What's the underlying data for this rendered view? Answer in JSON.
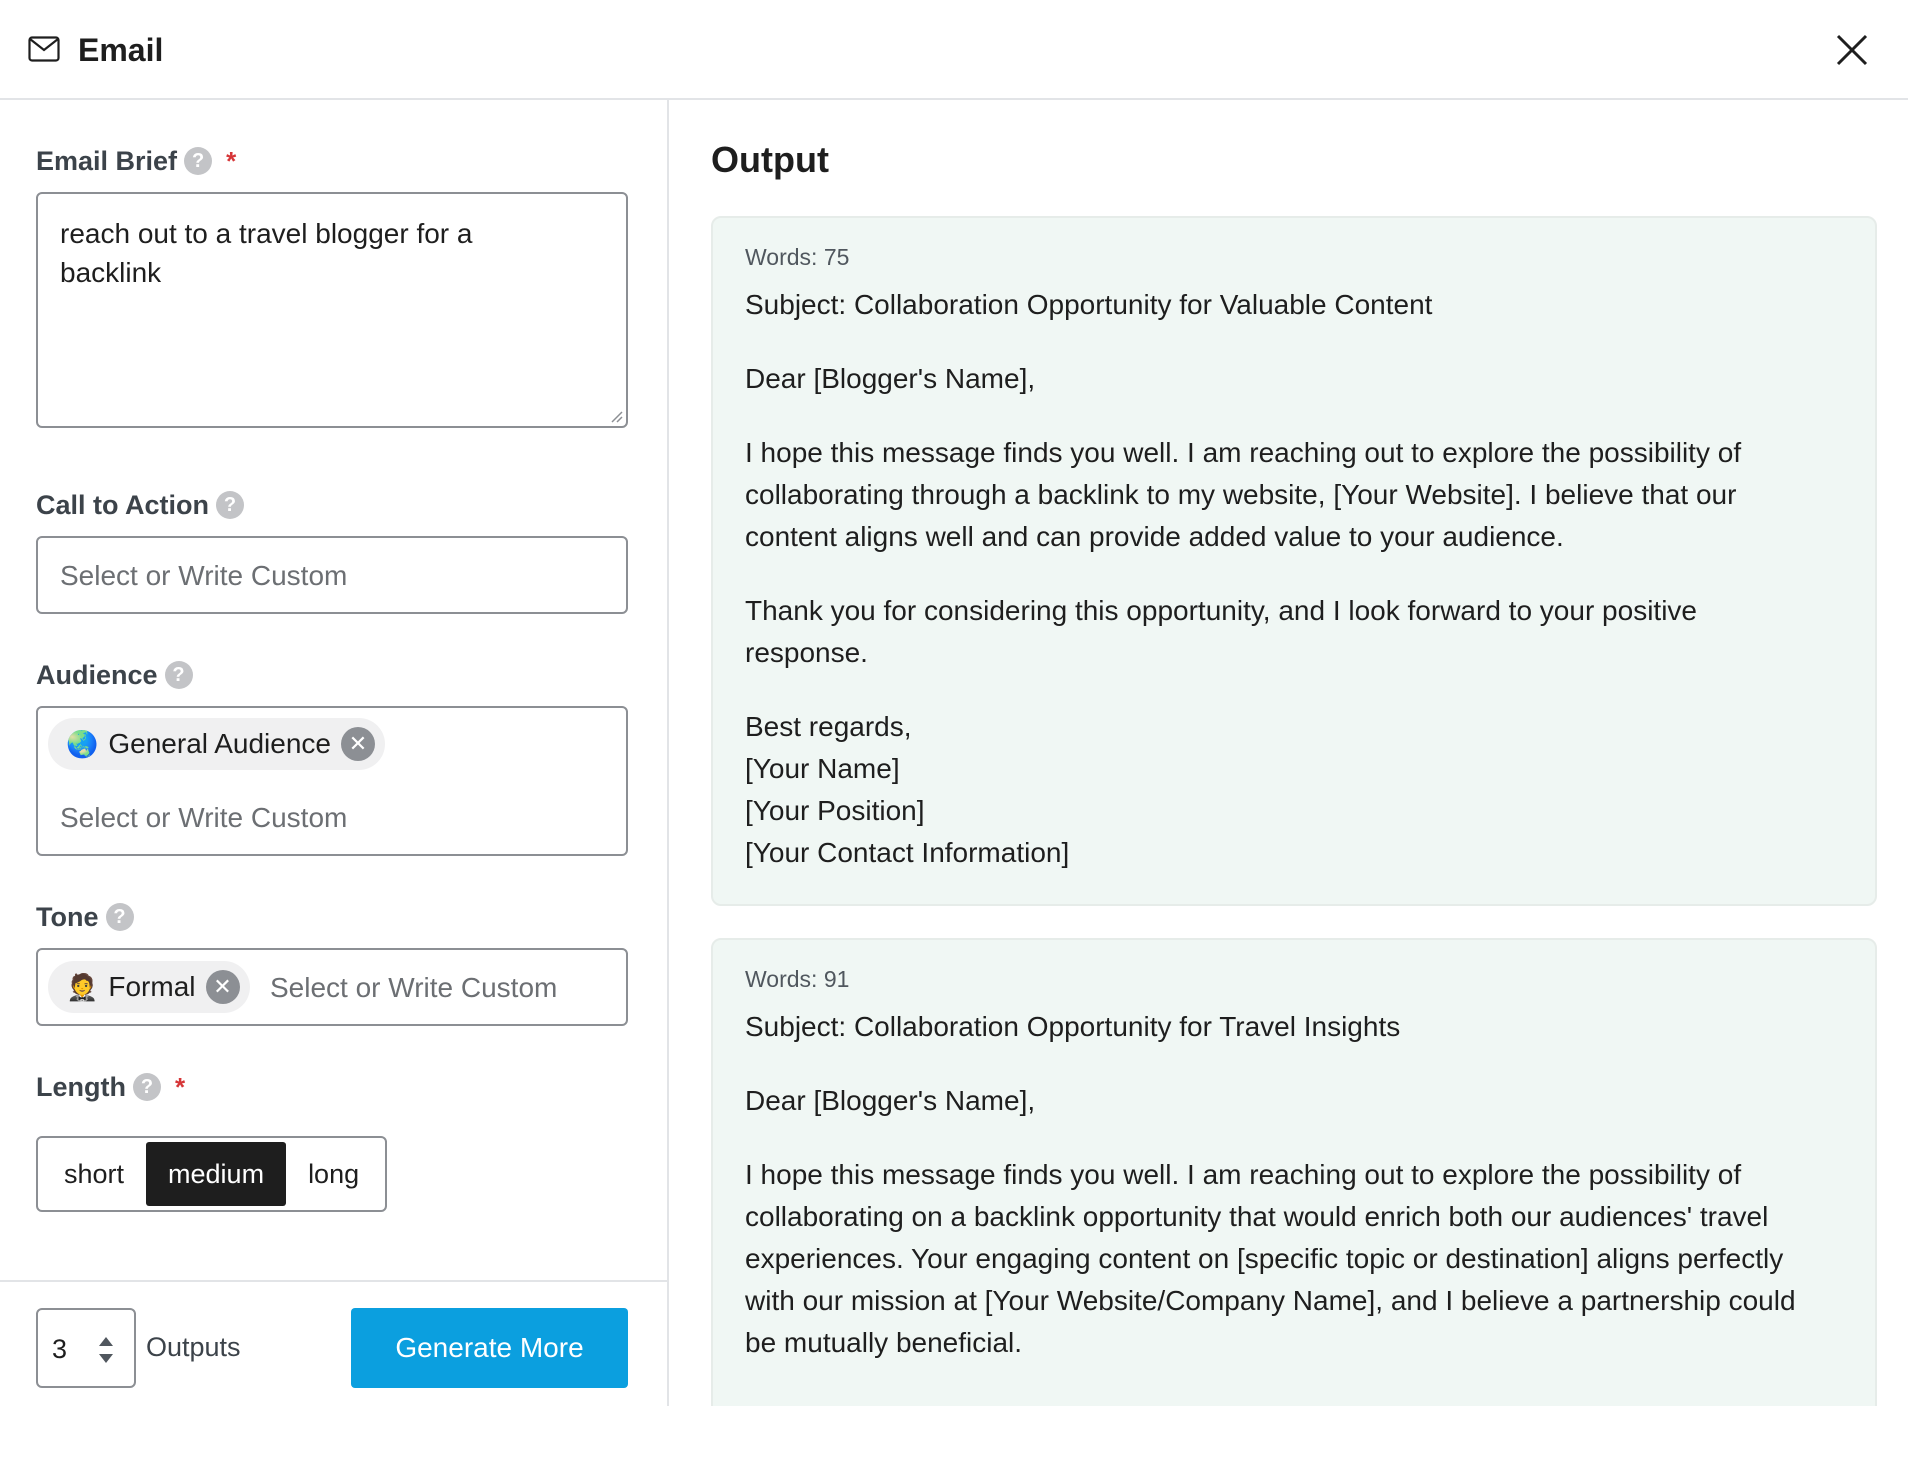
{
  "header": {
    "title": "Email"
  },
  "form": {
    "email_brief": {
      "label": "Email Brief",
      "help": "?",
      "required_mark": "*",
      "value_line1": "reach out to a travel blogger for a",
      "value_line2": "backlink"
    },
    "call_to_action": {
      "label": "Call to Action",
      "help": "?",
      "placeholder": "Select or Write Custom"
    },
    "audience": {
      "label": "Audience",
      "help": "?",
      "chip_emoji": "🌏",
      "chip_label": "General Audience",
      "chip_remove": "✕",
      "placeholder": "Select or Write Custom"
    },
    "tone": {
      "label": "Tone",
      "help": "?",
      "chip_emoji": "🤵",
      "chip_label": "Formal",
      "chip_remove": "✕",
      "placeholder": "Select or Write Custom"
    },
    "length": {
      "label": "Length",
      "help": "?",
      "required_mark": "*",
      "options": [
        "short",
        "medium",
        "long"
      ],
      "selected": "medium"
    }
  },
  "footer": {
    "outputs_count": "3",
    "outputs_label": "Outputs",
    "generate_label": "Generate More"
  },
  "output": {
    "title": "Output",
    "results": [
      {
        "words": "Words: 75",
        "subject": "Subject: Collaboration Opportunity for Valuable Content",
        "greeting": "Dear [Blogger's Name],",
        "para1_lines": [
          "I hope this message finds you well. I am reaching out to explore the possibility of",
          "collaborating through a backlink to my website, [Your Website]. I believe that our",
          "content aligns well and can provide added value to your audience."
        ],
        "para2_lines": [
          "Thank you for considering this opportunity, and I look forward to your positive",
          "response."
        ],
        "signoff_lines": [
          "Best regards,",
          "[Your Name]",
          "[Your Position]",
          "[Your Contact Information]"
        ]
      },
      {
        "words": "Words: 91",
        "subject": "Subject: Collaboration Opportunity for Travel Insights",
        "greeting": "Dear [Blogger's Name],",
        "para1_lines": [
          "I hope this message finds you well. I am reaching out to explore the possibility of",
          "collaborating on a backlink opportunity that would enrich both our audiences' travel",
          "experiences. Your engaging content on [specific topic or destination] aligns perfectly",
          "with our mission at [Your Website/Company Name], and I believe a partnership could",
          "be mutually beneficial."
        ]
      }
    ]
  },
  "colors": {
    "accent": "#0b9fdf",
    "card_bg": "#f0f7f4",
    "required": "#d63638",
    "selected_segment": "#1e1e1e"
  }
}
